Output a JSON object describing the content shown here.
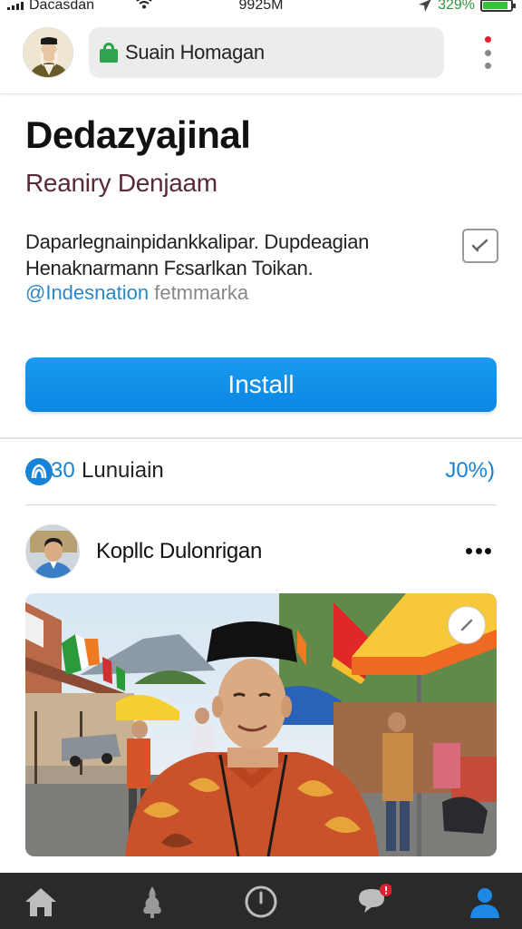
{
  "status_bar": {
    "carrier": "Dacasdan",
    "time": "9925M",
    "battery_percent": "329%",
    "battery_level": 0.9,
    "icons": [
      "signal-icon",
      "wifi-icon",
      "location-arrow-icon",
      "battery-icon"
    ]
  },
  "header": {
    "url": "Suain Homagan",
    "icons": [
      "profile-avatar",
      "lock-icon",
      "more-vert-icon"
    ],
    "notification_dot_color": "#e02030"
  },
  "app": {
    "title": "Dedazyajinal",
    "developer": "Reaniry Denjaam",
    "description_line1": "Daparlegnainpidankkalipar. Dupdeagian",
    "description_line2": "Henaknarmann Fɛsarlkan Toikan.",
    "tag_handle": "@Indesnation",
    "tag_text": "fetmmarka",
    "install_label": "Install",
    "accent_color": "#1683d6"
  },
  "stats": {
    "count": "30",
    "label": "Lunuiain",
    "percent": "J0%)"
  },
  "post": {
    "author": "Kopllc Dulonrigan",
    "icons": [
      "author-avatar",
      "more-horiz-icon",
      "expand-icon"
    ]
  },
  "bottom_nav": {
    "items": [
      "home-icon",
      "tree-icon",
      "clock-icon",
      "chat-icon",
      "profile-icon"
    ],
    "active": "profile-icon",
    "badge_color": "#e02030"
  }
}
